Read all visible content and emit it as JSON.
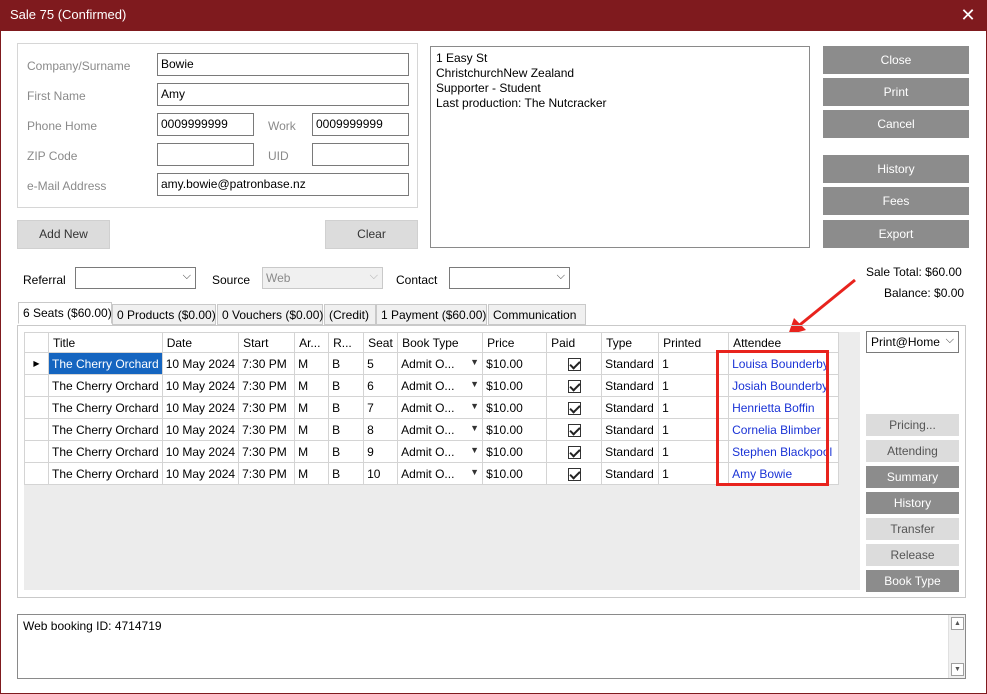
{
  "window": {
    "title": "Sale 75 (Confirmed)"
  },
  "customer": {
    "company_label": "Company/Surname",
    "company_value": "Bowie",
    "first_label": "First Name",
    "first_value": "Amy",
    "phone_label": "Phone Home",
    "phone_value": "0009999999",
    "work_label": "Work",
    "work_value": "0009999999",
    "zip_label": "ZIP Code",
    "zip_value": "",
    "uid_label": "UID",
    "uid_value": "",
    "email_label": "e-Mail Address",
    "email_value": "amy.bowie@patronbase.nz",
    "add_new_label": "Add New",
    "clear_label": "Clear"
  },
  "address": {
    "lines": [
      "1 Easy St",
      "ChristchurchNew Zealand",
      "Supporter - Student",
      "Last production: The Nutcracker"
    ]
  },
  "actions": {
    "close": "Close",
    "print": "Print",
    "cancel": "Cancel",
    "history": "History",
    "fees": "Fees",
    "export": "Export"
  },
  "filters": {
    "referral_label": "Referral",
    "referral_value": "",
    "source_label": "Source",
    "source_value": "Web",
    "contact_label": "Contact",
    "contact_value": ""
  },
  "totals": {
    "sale_total": "Sale Total: $60.00",
    "balance": "Balance: $0.00"
  },
  "tabs": [
    "6 Seats ($60.00)",
    "0 Products ($0.00)",
    "0 Vouchers ($0.00)",
    "(Credit)",
    "1 Payment ($60.00)",
    "Communication"
  ],
  "grid": {
    "columns": [
      "Title",
      "Date",
      "Start",
      "Ar...",
      "R...",
      "Seat",
      "Book Type",
      "Price",
      "Paid",
      "Type",
      "Printed",
      "Attendee"
    ],
    "rows": [
      {
        "title": "The Cherry Orchard",
        "date": "10 May 2024",
        "start": "7:30 PM",
        "area": "M",
        "row": "B",
        "seat": "5",
        "book_type": "Admit O...",
        "price": "$10.00",
        "type": "Standard",
        "printed": "1",
        "attendee": "Louisa  Bounderby"
      },
      {
        "title": "The Cherry Orchard",
        "date": "10 May 2024",
        "start": "7:30 PM",
        "area": "M",
        "row": "B",
        "seat": "6",
        "book_type": "Admit O...",
        "price": "$10.00",
        "type": "Standard",
        "printed": "1",
        "attendee": "Josiah Bounderby"
      },
      {
        "title": "The Cherry Orchard",
        "date": "10 May 2024",
        "start": "7:30 PM",
        "area": "M",
        "row": "B",
        "seat": "7",
        "book_type": "Admit O...",
        "price": "$10.00",
        "type": "Standard",
        "printed": "1",
        "attendee": "Henrietta  Boffin"
      },
      {
        "title": "The Cherry Orchard",
        "date": "10 May 2024",
        "start": "7:30 PM",
        "area": "M",
        "row": "B",
        "seat": "8",
        "book_type": "Admit O...",
        "price": "$10.00",
        "type": "Standard",
        "printed": "1",
        "attendee": "Cornelia Blimber"
      },
      {
        "title": "The Cherry Orchard",
        "date": "10 May 2024",
        "start": "7:30 PM",
        "area": "M",
        "row": "B",
        "seat": "9",
        "book_type": "Admit O...",
        "price": "$10.00",
        "type": "Standard",
        "printed": "1",
        "attendee": "Stephen Blackpool"
      },
      {
        "title": "The Cherry Orchard",
        "date": "10 May 2024",
        "start": "7:30 PM",
        "area": "M",
        "row": "B",
        "seat": "10",
        "book_type": "Admit O...",
        "price": "$10.00",
        "type": "Standard",
        "printed": "1",
        "attendee": "Amy Bowie"
      }
    ]
  },
  "side_panel": {
    "print_option": "Print@Home",
    "pricing": "Pricing...",
    "attending": "Attending",
    "summary": "Summary",
    "history": "History",
    "transfer": "Transfer",
    "release": "Release",
    "book_type": "Book Type"
  },
  "notes": {
    "text": "Web booking ID: 4714719"
  },
  "colors": {
    "titlebar": "#7f1a1e",
    "highlight_box": "#e8231d",
    "selection": "#1565c0",
    "attendee_link": "#1a33d6"
  }
}
